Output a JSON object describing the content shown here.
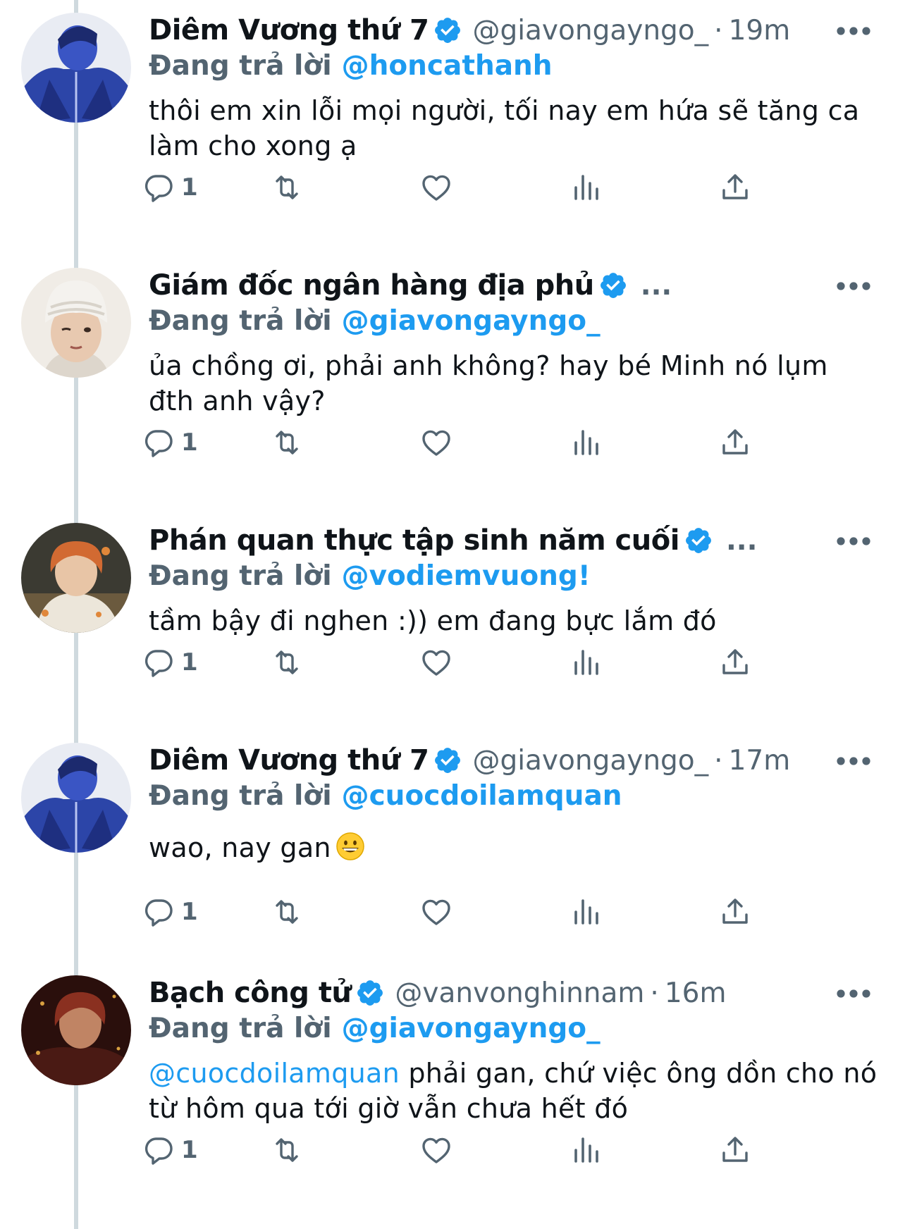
{
  "tweets": [
    {
      "name": "Diêm Vương thứ 7",
      "handle": "@giavongayngo_",
      "dot": "·",
      "time": "19m",
      "replying_label": "Đang trả lời",
      "replying_to": "@honcathanh",
      "text": "thôi em xin lỗi mọi người, tối nay em hứa sẽ tăng ca làm cho xong ạ",
      "reply_count": "1",
      "avatar": "blue-jacket-avatar"
    },
    {
      "name": "Giám đốc ngân hàng địa phủ",
      "truncated": "...",
      "replying_label": "Đang trả lời",
      "replying_to": "@giavongayngo_",
      "text": "ủa chồng ơi, phải anh không? hay bé Minh nó lụm đth anh vậy?",
      "reply_count": "1",
      "avatar": "white-beanie-avatar"
    },
    {
      "name": "Phán quan thực tập sinh năm cuối",
      "truncated": "...",
      "replying_label": "Đang trả lời",
      "replying_to": "@vodiemvuong!",
      "text": "tầm bậy đi nghen :)) em đang bực lắm đó",
      "reply_count": "1",
      "avatar": "orange-hair-avatar"
    },
    {
      "name": "Diêm Vương thứ 7",
      "handle": "@giavongayngo_",
      "dot": "·",
      "time": "17m",
      "replying_label": "Đang trả lời",
      "replying_to": "@cuocdoilamquan",
      "text": "wao, nay gan",
      "emoji": "grinning-face-emoji",
      "reply_count": "1",
      "avatar": "blue-jacket-avatar"
    },
    {
      "name": "Bạch công tử",
      "handle": "@vanvonghinnam",
      "dot": "·",
      "time": "16m",
      "replying_label": "Đang trả lời",
      "replying_to": "@giavongayngo_",
      "text_mention": "@cuocdoilamquan",
      "text": " phải gan, chứ việc ông dồn cho nó từ hôm qua tới giờ vẫn chưa hết đó",
      "reply_count": "1",
      "avatar": "dark-red-avatar"
    }
  ],
  "colors": {
    "accent": "#1d9bf0",
    "muted": "#536471",
    "text": "#0f1419",
    "thread_line": "#cfd9de"
  }
}
